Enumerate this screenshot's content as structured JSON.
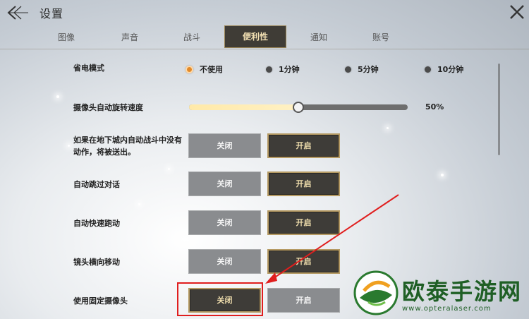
{
  "header": {
    "title": "设置",
    "back_icon": "back-chevron-icon",
    "close_icon": "close-icon"
  },
  "tabs": [
    {
      "label": "图像",
      "active": false
    },
    {
      "label": "声音",
      "active": false
    },
    {
      "label": "战斗",
      "active": false
    },
    {
      "label": "便利性",
      "active": true
    },
    {
      "label": "通知",
      "active": false
    },
    {
      "label": "账号",
      "active": false
    }
  ],
  "settings": {
    "power_saving": {
      "label": "省电模式",
      "options": [
        "不使用",
        "1分钟",
        "5分钟",
        "10分钟"
      ],
      "selected": "不使用"
    },
    "camera_rotate_speed": {
      "label": "摄像头自动旋转速度",
      "value": 0.5,
      "value_text": "50%"
    },
    "toggles": [
      {
        "label": "如果在地下城内自动战斗中没有动作，将被送出。",
        "off_label": "关闭",
        "on_label": "开启",
        "state": "on"
      },
      {
        "label": "自动跳过对话",
        "off_label": "关闭",
        "on_label": "开启",
        "state": "on"
      },
      {
        "label": "自动快速跑动",
        "off_label": "关闭",
        "on_label": "开启",
        "state": "on"
      },
      {
        "label": "镜头横向移动",
        "off_label": "关闭",
        "on_label": "开启",
        "state": "on"
      },
      {
        "label": "使用固定摄像头",
        "off_label": "关闭",
        "on_label": "开启",
        "state": "off"
      }
    ]
  },
  "colors": {
    "active_tab_bg": "#3f3c36",
    "active_gold": "#f1dfb2",
    "annotation_red": "#e01e1e",
    "radio_selected": "#e28a2a"
  },
  "watermark": {
    "brand": "欧泰手游网",
    "url": "www.opteralaser.com"
  }
}
